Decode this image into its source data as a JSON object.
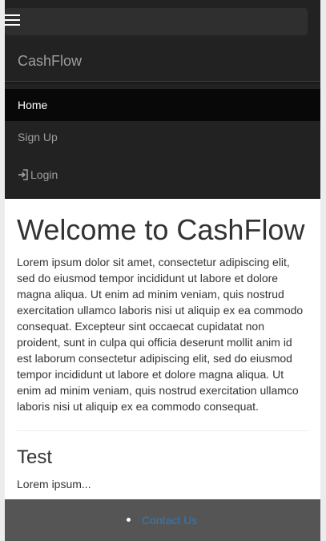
{
  "navbar": {
    "brand": "CashFlow",
    "items": [
      {
        "label": "Home"
      },
      {
        "label": "Sign Up"
      },
      {
        "label": "Login"
      }
    ]
  },
  "main": {
    "heading": "Welcome to CashFlow",
    "intro": "Lorem ipsum dolor sit amet, consectetur adipiscing elit, sed do eiusmod tempor incididunt ut labore et dolore magna aliqua. Ut enim ad minim veniam, quis nostrud exercitation ullamco laboris nisi ut aliquip ex ea commodo consequat. Excepteur sint occaecat cupidatat non proident, sunt in culpa qui officia deserunt mollit anim id est laborum consectetur adipiscing elit, sed do eiusmod tempor incididunt ut labore et dolore magna aliqua. Ut enim ad minim veniam, quis nostrud exercitation ullamco laboris nisi ut aliquip ex ea commodo consequat.",
    "section_title": "Test",
    "section_text": "Lorem ipsum..."
  },
  "footer": {
    "links": [
      {
        "label": "Contact Us"
      }
    ]
  },
  "colors": {
    "navbar_bg": "#222222",
    "active_bg": "#080808",
    "footer_bg": "#555555",
    "link": "#337ab7"
  }
}
